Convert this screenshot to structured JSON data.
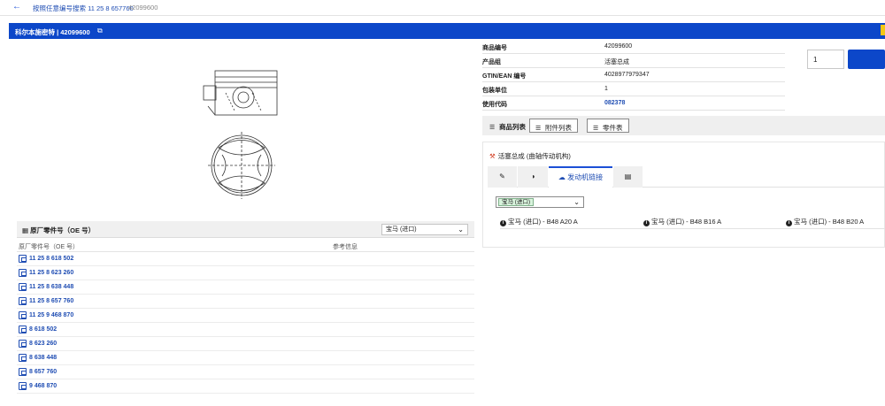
{
  "topbar": {
    "back_icon": "arrow-left-icon",
    "breadcrumb": "按照任意编号搜索 11 25 8 657760",
    "breadcrumb_id": "42099600"
  },
  "header": {
    "title": "科尔本施密特 | 42099600",
    "copy_icon": "copy-icon",
    "accent": "#0c47c9"
  },
  "oe": {
    "title": "原厂零件号（OE 号）",
    "brand_select": "宝马 (进口)",
    "col_number": "原厂零件号（OE 号）",
    "col_ref": "参考信息",
    "rows": [
      "11 25 8 618 502",
      "11 25 8 623 260",
      "11 25 8 638 448",
      "11 25 8 657 760",
      "11 25 9 468 870",
      "8 618 502",
      "8 623 260",
      "8 638 448",
      "8 657 760",
      "9 468 870"
    ]
  },
  "details": {
    "rows": [
      {
        "key": "商品编号",
        "value": "42099600"
      },
      {
        "key": "产品组",
        "value": "活塞总成"
      },
      {
        "key": "GTIN/EAN 编号",
        "value": "4028977979347"
      },
      {
        "key": "包装单位",
        "value": "1"
      },
      {
        "key": "使用代码",
        "value": "082378"
      }
    ]
  },
  "cart": {
    "quantity": "1"
  },
  "tabs": {
    "items": [
      "商品列表",
      "附件列表",
      "零件表"
    ]
  },
  "assembly": {
    "title": "活塞总成 (曲轴传动机构)",
    "subtab_active": "发动机链接",
    "brand_select": "宝马 (进口)",
    "engines": [
      "宝马 (进口) - B48 A20 A",
      "宝马 (进口) - B48 B16 A",
      "宝马 (进口) - B48 B20 A"
    ]
  }
}
